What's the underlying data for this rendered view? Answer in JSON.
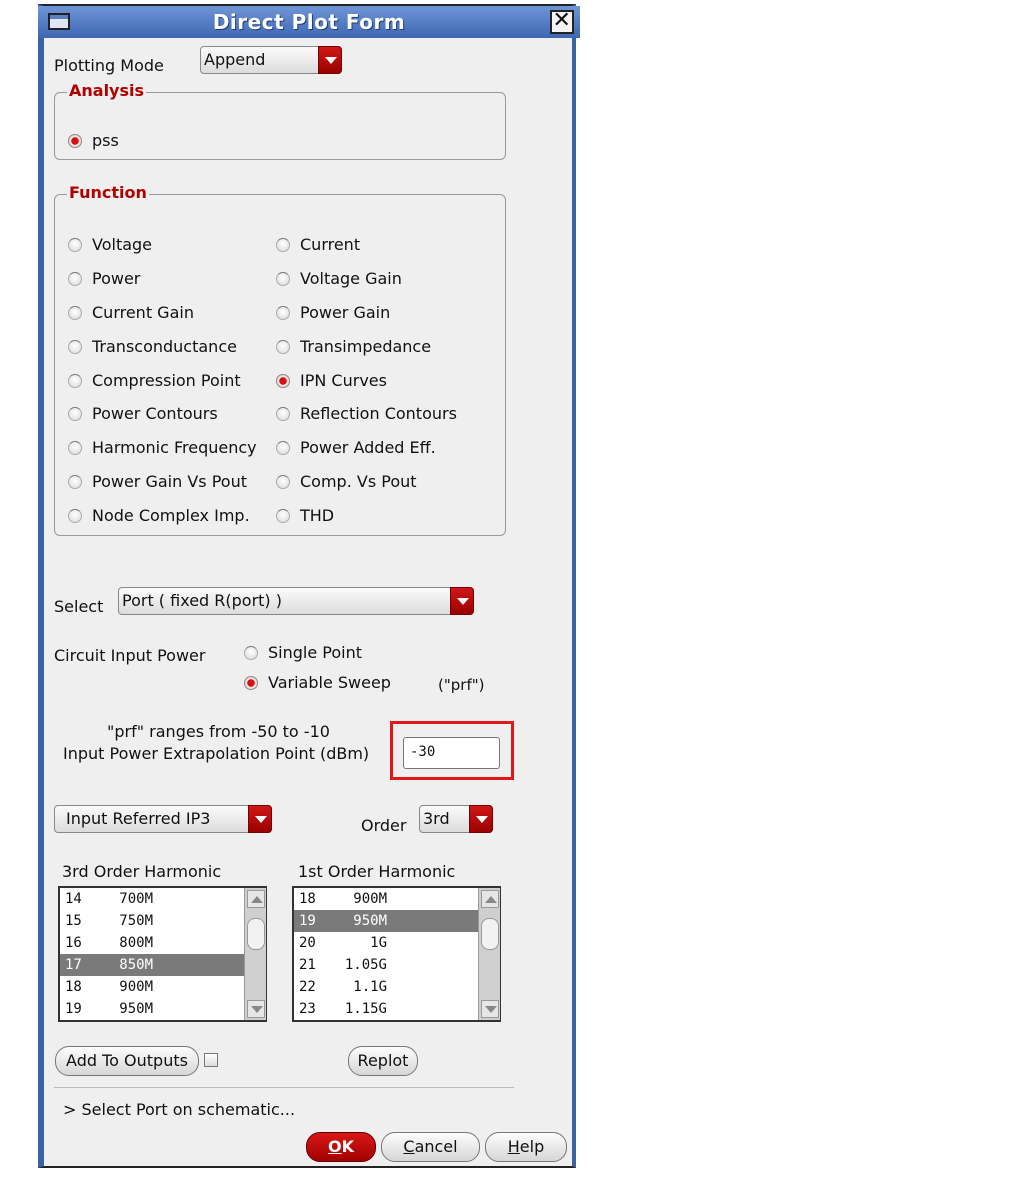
{
  "window": {
    "title": "Direct Plot Form",
    "close_glyph": "✕"
  },
  "plotting_mode": {
    "label": "Plotting Mode",
    "value": "Append"
  },
  "analysis": {
    "title": "Analysis",
    "option": "pss"
  },
  "function": {
    "title": "Function",
    "left": [
      "Voltage",
      "Power",
      "Current Gain",
      "Transconductance",
      "Compression Point",
      "Power Contours",
      "Harmonic Frequency",
      "Power Gain Vs Pout",
      "Node Complex Imp."
    ],
    "right": [
      "Current",
      "Voltage Gain",
      "Power Gain",
      "Transimpedance",
      "IPN Curves",
      "Reflection Contours",
      "Power Added Eff.",
      "Comp. Vs Pout",
      "THD"
    ],
    "selected": "IPN Curves"
  },
  "select": {
    "label": "Select",
    "value": "Port ( fixed R(port) )"
  },
  "circuit_input_power": {
    "label": "Circuit Input Power",
    "option_single": "Single Point",
    "option_sweep": "Variable Sweep",
    "sweep_var": "(\"prf\")"
  },
  "extrapolation": {
    "range_text": "\"prf\" ranges from -50 to -10",
    "label": "Input Power Extrapolation Point (dBm)",
    "value": "-30"
  },
  "measure": {
    "value": "Input Referred IP3",
    "order_label": "Order",
    "order_value": "3rd"
  },
  "list_3rd": {
    "title": "3rd Order Harmonic",
    "rows": [
      [
        "14",
        "700M"
      ],
      [
        "15",
        "750M"
      ],
      [
        "16",
        "800M"
      ],
      [
        "17",
        "850M"
      ],
      [
        "18",
        "900M"
      ],
      [
        "19",
        "950M"
      ]
    ],
    "selected_index": 3
  },
  "list_1st": {
    "title": "1st Order Harmonic",
    "rows": [
      [
        "18",
        "900M"
      ],
      [
        "19",
        "950M"
      ],
      [
        "20",
        "1G"
      ],
      [
        "21",
        "1.05G"
      ],
      [
        "22",
        "1.1G"
      ],
      [
        "23",
        "1.15G"
      ]
    ],
    "selected_index": 1
  },
  "buttons": {
    "add_to_outputs": "Add To Outputs",
    "replot": "Replot",
    "ok_u": "O",
    "ok_rest": "K",
    "cancel_u": "C",
    "cancel_rest": "ancel",
    "help_u": "H",
    "help_rest": "elp"
  },
  "status": "> Select Port on schematic..."
}
